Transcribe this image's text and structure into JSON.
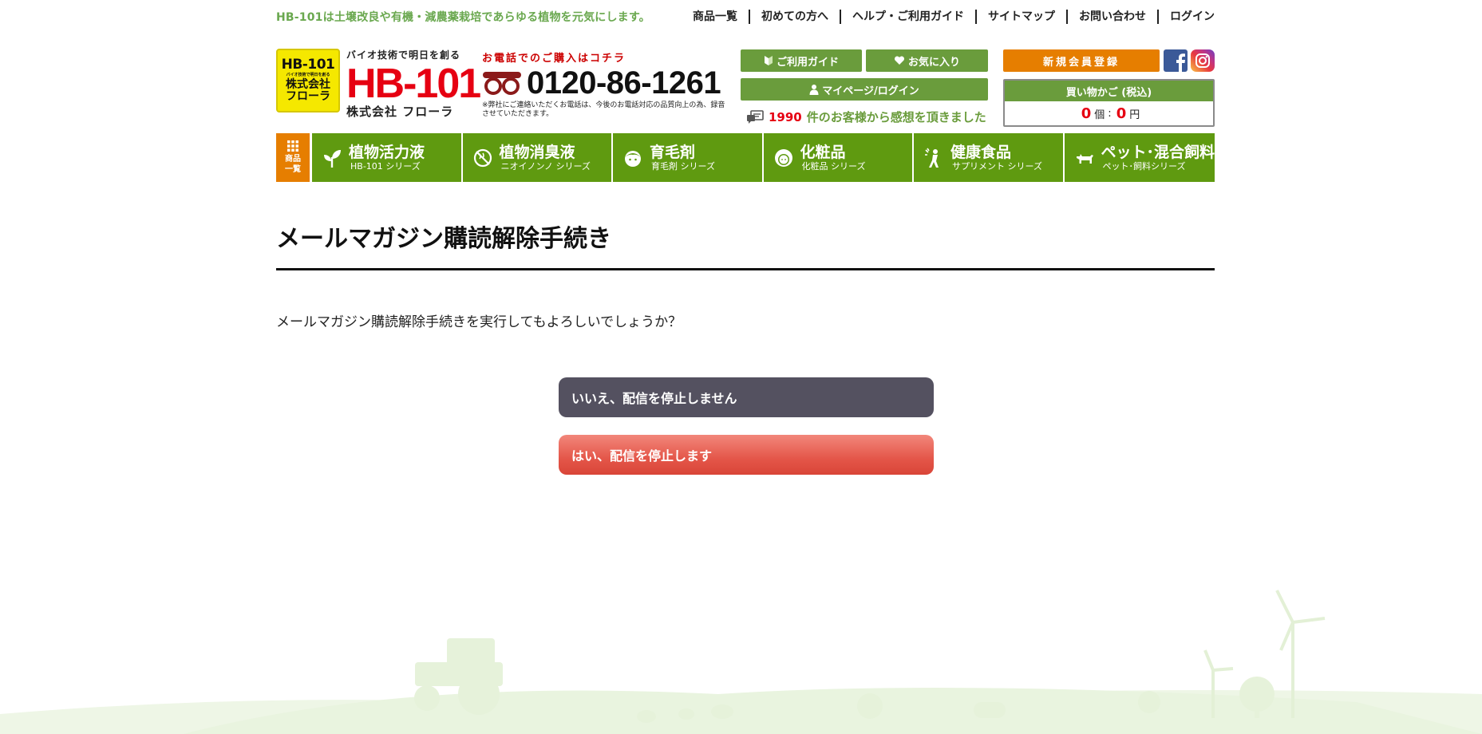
{
  "topbar": {
    "tagline": "HB-101は土壌改良や有機・減農薬栽培であらゆる植物を元気にします。",
    "links": [
      "商品一覧",
      "初めての方へ",
      "ヘルプ・ご利用ガイド",
      "サイトマップ",
      "お問い合わせ",
      "ログイン"
    ]
  },
  "logo": {
    "line1": "HB-101",
    "line2": "バイオ技術で明日を創る",
    "line3a": "株式会社",
    "line3b": "フローラ"
  },
  "brand": {
    "catch": "バイオ技術で明日を創る",
    "name": "HB-101",
    "company": "株式会社 フローラ"
  },
  "phone": {
    "lead": "お電話でのご購入はコチラ",
    "number": "0120-86-1261",
    "note": "※弊社にご連絡いただくお電話は、今後のお電話対応の品質向上の為、録音させていただきます。"
  },
  "header_buttons": {
    "guide": "ご利用ガイド",
    "favorite": "お気に入り",
    "mypage": "マイページ/ログイン",
    "register": "新規会員登録"
  },
  "voice": {
    "count": "1990",
    "text": "件のお客様から感想を頂きました"
  },
  "cart": {
    "title": "買い物かご (税込)",
    "items": "0",
    "items_unit": "個",
    "separator": ":",
    "amount": "0",
    "amount_unit": "円"
  },
  "nav": {
    "all_line1": "商品",
    "all_line2": "一覧",
    "items": [
      {
        "main": "植物活力液",
        "sub": "HB-101 シリーズ"
      },
      {
        "main": "植物消臭液",
        "sub": "ニオイノンノ シリーズ"
      },
      {
        "main": "育毛剤",
        "sub": "育毛剤 シリーズ"
      },
      {
        "main": "化粧品",
        "sub": "化粧品 シリーズ"
      },
      {
        "main": "健康食品",
        "sub": "サプリメント シリーズ"
      },
      {
        "main": "ペット･混合飼料",
        "sub": "ペット･飼料シリーズ"
      }
    ]
  },
  "content": {
    "title": "メールマガジン購読解除手続き",
    "question": "メールマガジン購読解除手続きを実行してもよろしいでしょうか？",
    "no_button": "いいえ、配信を停止しません",
    "yes_button": "はい、配信を停止します"
  },
  "colors": {
    "green": "#5f9a10",
    "green_button": "#6a9c3c",
    "orange": "#e67e00",
    "red": "#e60012",
    "dark_button": "#545160",
    "coral_button": "#e45649"
  }
}
